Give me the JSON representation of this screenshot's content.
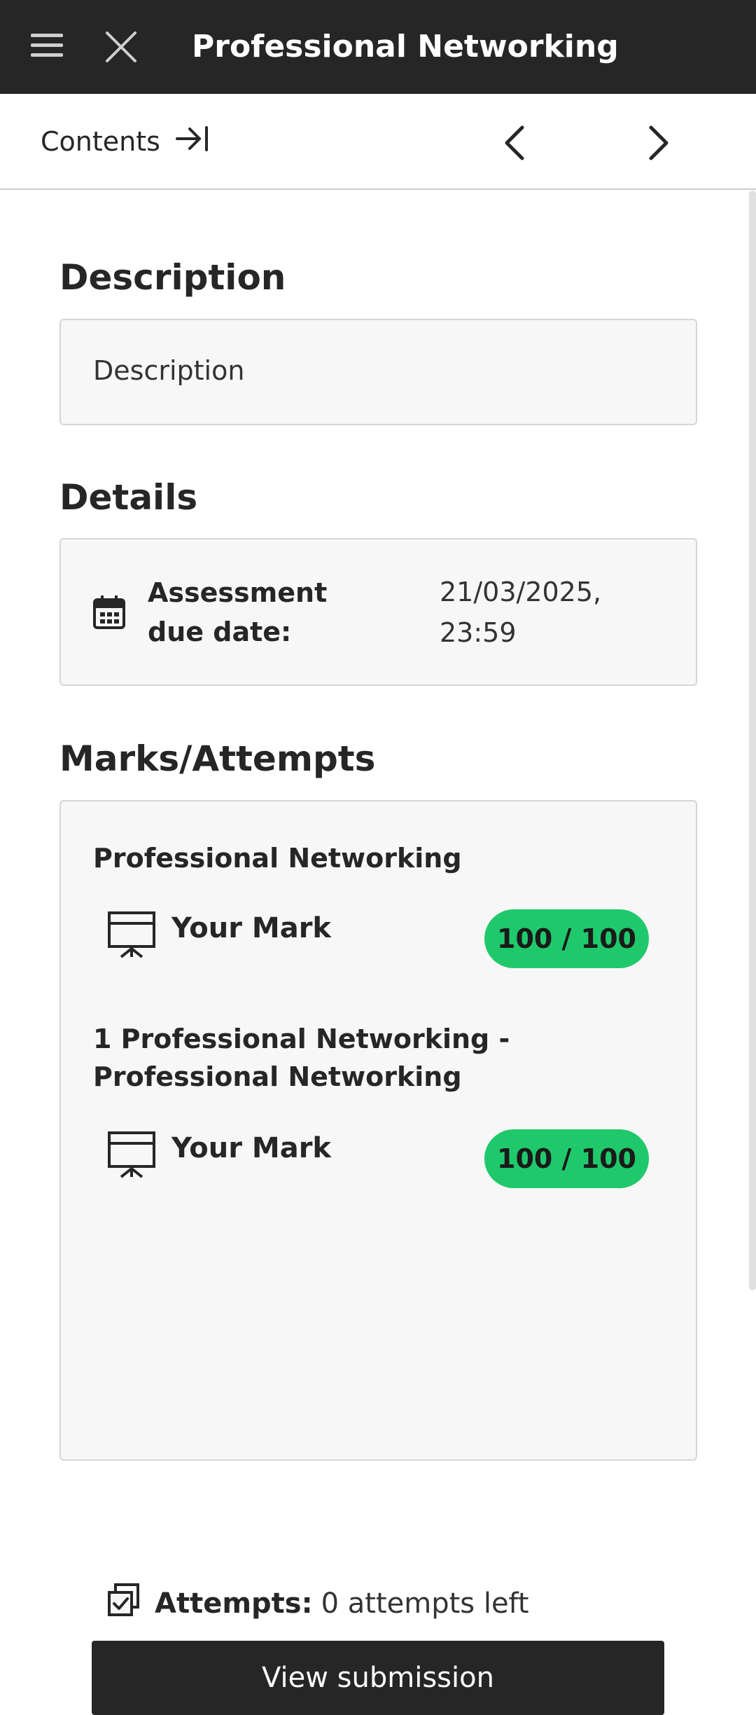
{
  "header": {
    "title": "Professional Networking",
    "menu_icon": "hamburger-menu-icon",
    "close_icon": "close-icon"
  },
  "nav": {
    "contents_label": "Contents",
    "contents_icon": "arrow-to-right-bar-icon",
    "prev_icon": "chevron-left-icon",
    "next_icon": "chevron-right-icon"
  },
  "description": {
    "heading": "Description",
    "text": "Description"
  },
  "details": {
    "heading": "Details",
    "icon": "calendar-icon",
    "due_label": "Assessment due date:",
    "due_value": "21/03/2025, 23:59"
  },
  "marks": {
    "heading": "Marks/Attempts",
    "items": [
      {
        "title": "Professional Networking",
        "mark_label": "Your Mark",
        "mark_value": "100 / 100",
        "icon": "presentation-board-icon"
      },
      {
        "title": "1 Professional Networking - Professional Networking",
        "mark_label": "Your Mark",
        "mark_value": "100 / 100",
        "icon": "presentation-board-icon"
      }
    ],
    "attempts_label": "Attempts:",
    "attempts_value": "0 attempts left",
    "attempts_icon": "multiple-checkbox-icon",
    "view_submission_label": "View submission"
  },
  "colors": {
    "header_bg": "#262626",
    "mark_pill": "#1fc96b",
    "card_bg": "#f7f7f7",
    "button_bg": "#262626"
  }
}
